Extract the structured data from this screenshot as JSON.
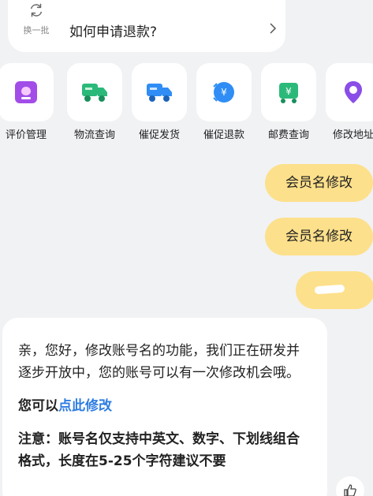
{
  "question_card": {
    "refresh_label": "换一批",
    "question": "如何申请退款?"
  },
  "services": [
    {
      "label": "评价管理",
      "icon": "review-icon",
      "color": "#a24de8"
    },
    {
      "label": "物流查询",
      "icon": "truck-icon",
      "color": "#2bb97a"
    },
    {
      "label": "催促发货",
      "icon": "truck-fast-icon",
      "color": "#2f8df5"
    },
    {
      "label": "催促退款",
      "icon": "refund-bell-icon",
      "color": "#2f8df5"
    },
    {
      "label": "邮费查询",
      "icon": "postage-icon",
      "color": "#2bb97a"
    },
    {
      "label": "修改地址",
      "icon": "location-pin-icon",
      "color": "#8a4de8"
    }
  ],
  "messages": {
    "user_1": "会员名修改",
    "user_2": "会员名修改"
  },
  "reply": {
    "paragraph_1": "亲，您好，修改账号名的功能，我们正在研发并逐步开放中，您的账号可以有一次修改机会哦。",
    "action_prefix": "您可以",
    "action_link": "点此修改",
    "note": "注意：账号名仅支持中英文、数字、下划线组合格式，长度在5-25个字符建议不要"
  },
  "colors": {
    "user_bubble": "#fde08b",
    "link": "#2f7de1",
    "background": "#f1f2f4"
  }
}
